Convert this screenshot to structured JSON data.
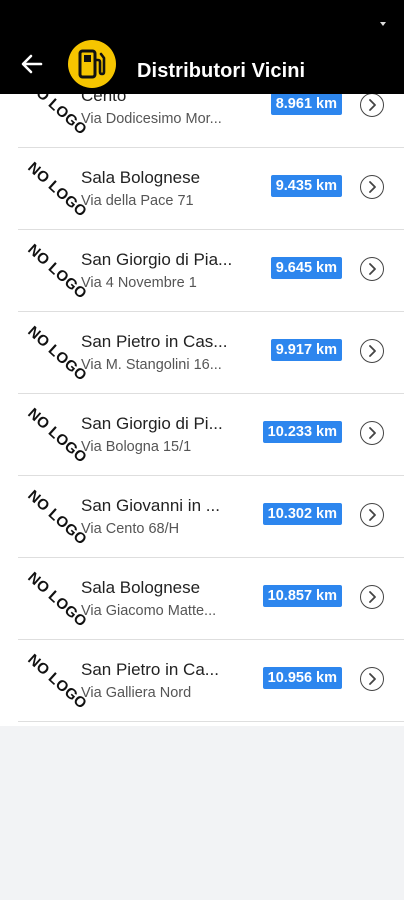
{
  "app_bar": {
    "title": "Distributori Vicini",
    "back_icon": "arrow-left-icon",
    "logo_icon": "fuel-pump-icon",
    "logo_color": "#f6c500"
  },
  "colors": {
    "distance_badge": "#2d86ee",
    "app_bar": "#000000"
  },
  "stations": [
    {
      "logo_text": "NO LOGO",
      "name": "Cento",
      "address": "Via Dodicesimo Mor...",
      "distance": "8.961 km"
    },
    {
      "logo_text": "NO LOGO",
      "name": "Sala Bolognese",
      "address": "Via della Pace 71",
      "distance": "9.435 km"
    },
    {
      "logo_text": "NO LOGO",
      "name": "San Giorgio di Pia...",
      "address": "Via 4 Novembre 1",
      "distance": "9.645 km"
    },
    {
      "logo_text": "NO LOGO",
      "name": "San Pietro in Cas...",
      "address": "Via M. Stangolini 16...",
      "distance": "9.917 km"
    },
    {
      "logo_text": "NO LOGO",
      "name": "San Giorgio di Pi...",
      "address": "Via Bologna 15/1",
      "distance": "10.233 km"
    },
    {
      "logo_text": "NO LOGO",
      "name": "San Giovanni in ...",
      "address": "Via Cento 68/H",
      "distance": "10.302 km"
    },
    {
      "logo_text": "NO LOGO",
      "name": "Sala Bolognese",
      "address": "Via Giacomo Matte...",
      "distance": "10.857 km"
    },
    {
      "logo_text": "NO LOGO",
      "name": "San Pietro in Ca...",
      "address": "Via Galliera Nord",
      "distance": "10.956 km"
    }
  ]
}
